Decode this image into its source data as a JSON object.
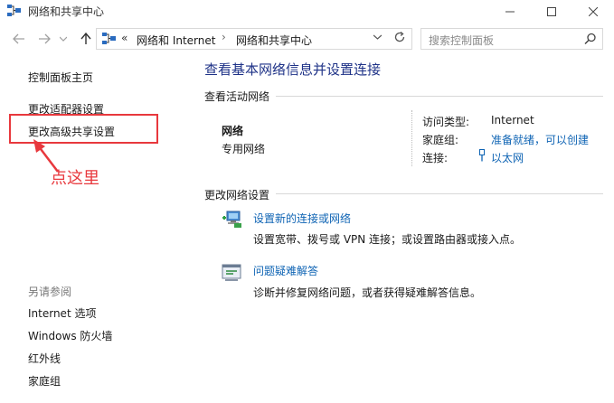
{
  "window": {
    "title": "网络和共享中心",
    "minimize_icon": "minimize-icon",
    "maximize_icon": "maximize-icon",
    "close_icon": "close-icon"
  },
  "navigation": {
    "back_icon": "arrow-left-icon",
    "forward_icon": "arrow-right-icon",
    "up_icon": "arrow-up-icon",
    "address": {
      "overflow": "«",
      "segments": [
        "网络和 Internet",
        "网络和共享中心"
      ],
      "separator": "›"
    },
    "search": {
      "placeholder": "搜索控制面板"
    }
  },
  "sidebar": {
    "home": "控制面板主页",
    "links": [
      "更改适配器设置",
      "更改高级共享设置"
    ],
    "see_also_label": "另请参阅",
    "see_also": [
      "Internet 选项",
      "Windows 防火墙",
      "红外线",
      "家庭组"
    ]
  },
  "annotation": {
    "text": "点这里",
    "color": "#e8383d"
  },
  "main": {
    "title": "查看基本网络信息并设置连接",
    "active_networks_heading": "查看活动网络",
    "network": {
      "name": "网络",
      "type": "专用网络",
      "access_type_label": "访问类型:",
      "access_type_value": "Internet",
      "homegroup_label": "家庭组:",
      "homegroup_value": "准备就绪，可以创建",
      "connections_label": "连接:",
      "connections_value": "以太网"
    },
    "change_settings_heading": "更改网络设置",
    "tasks": [
      {
        "link": "设置新的连接或网络",
        "description": "设置宽带、拨号或 VPN 连接；或设置路由器或接入点。",
        "icon": "new-connection-icon"
      },
      {
        "link": "问题疑难解答",
        "description": "诊断并修复网络问题，或者获得疑难解答信息。",
        "icon": "troubleshoot-icon"
      }
    ]
  },
  "colors": {
    "title_blue": "#1e3287",
    "link_blue": "#0f64b4",
    "annotation_red": "#e8383d"
  }
}
